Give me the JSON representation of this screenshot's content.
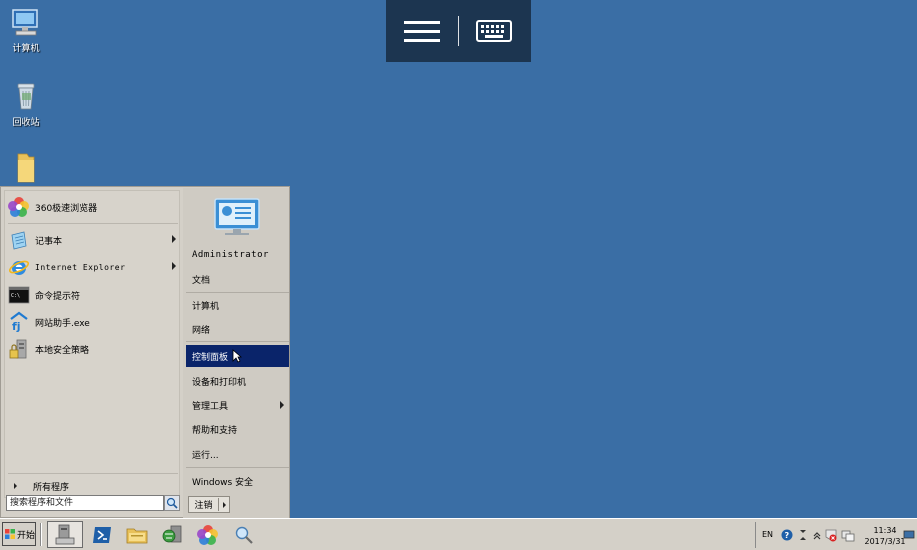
{
  "desktop": {
    "icons": [
      {
        "label": "计算机"
      },
      {
        "label": "回收站"
      },
      {
        "label": ""
      }
    ]
  },
  "start_menu": {
    "pinned": [
      {
        "label": "360极速浏览器",
        "icon": "360-browser-icon"
      }
    ],
    "programs": [
      {
        "label": "记事本",
        "has_submenu": true,
        "icon": "notepad-icon"
      },
      {
        "label": "Internet Explorer",
        "has_submenu": true,
        "icon": "internet-explorer-icon"
      },
      {
        "label": "命令提示符",
        "has_submenu": false,
        "icon": "command-prompt-icon"
      },
      {
        "label": "网站助手.exe",
        "has_submenu": false,
        "icon": "website-assistant-icon"
      },
      {
        "label": "本地安全策略",
        "has_submenu": false,
        "icon": "security-policy-icon"
      }
    ],
    "all_programs_label": "所有程序",
    "search_placeholder": "搜索程序和文件",
    "right": {
      "user": "Administrator",
      "documents": "文档",
      "computer": "计算机",
      "network": "网络",
      "control_panel": "控制面板",
      "devices_printers": "设备和打印机",
      "admin_tools": "管理工具",
      "help_support": "帮助和支持",
      "run": "运行...",
      "windows_security": "Windows 安全",
      "shutdown_label": "注销"
    },
    "selected_item": "控制面板"
  },
  "taskbar": {
    "start_label": "开始",
    "tray": {
      "language": "EN",
      "time": "11:34",
      "date": "2017/3/31"
    }
  },
  "colors": {
    "desktop": "#3a6ea5",
    "selection": "#0a246a",
    "menu_bg": "#d4d0c8"
  }
}
